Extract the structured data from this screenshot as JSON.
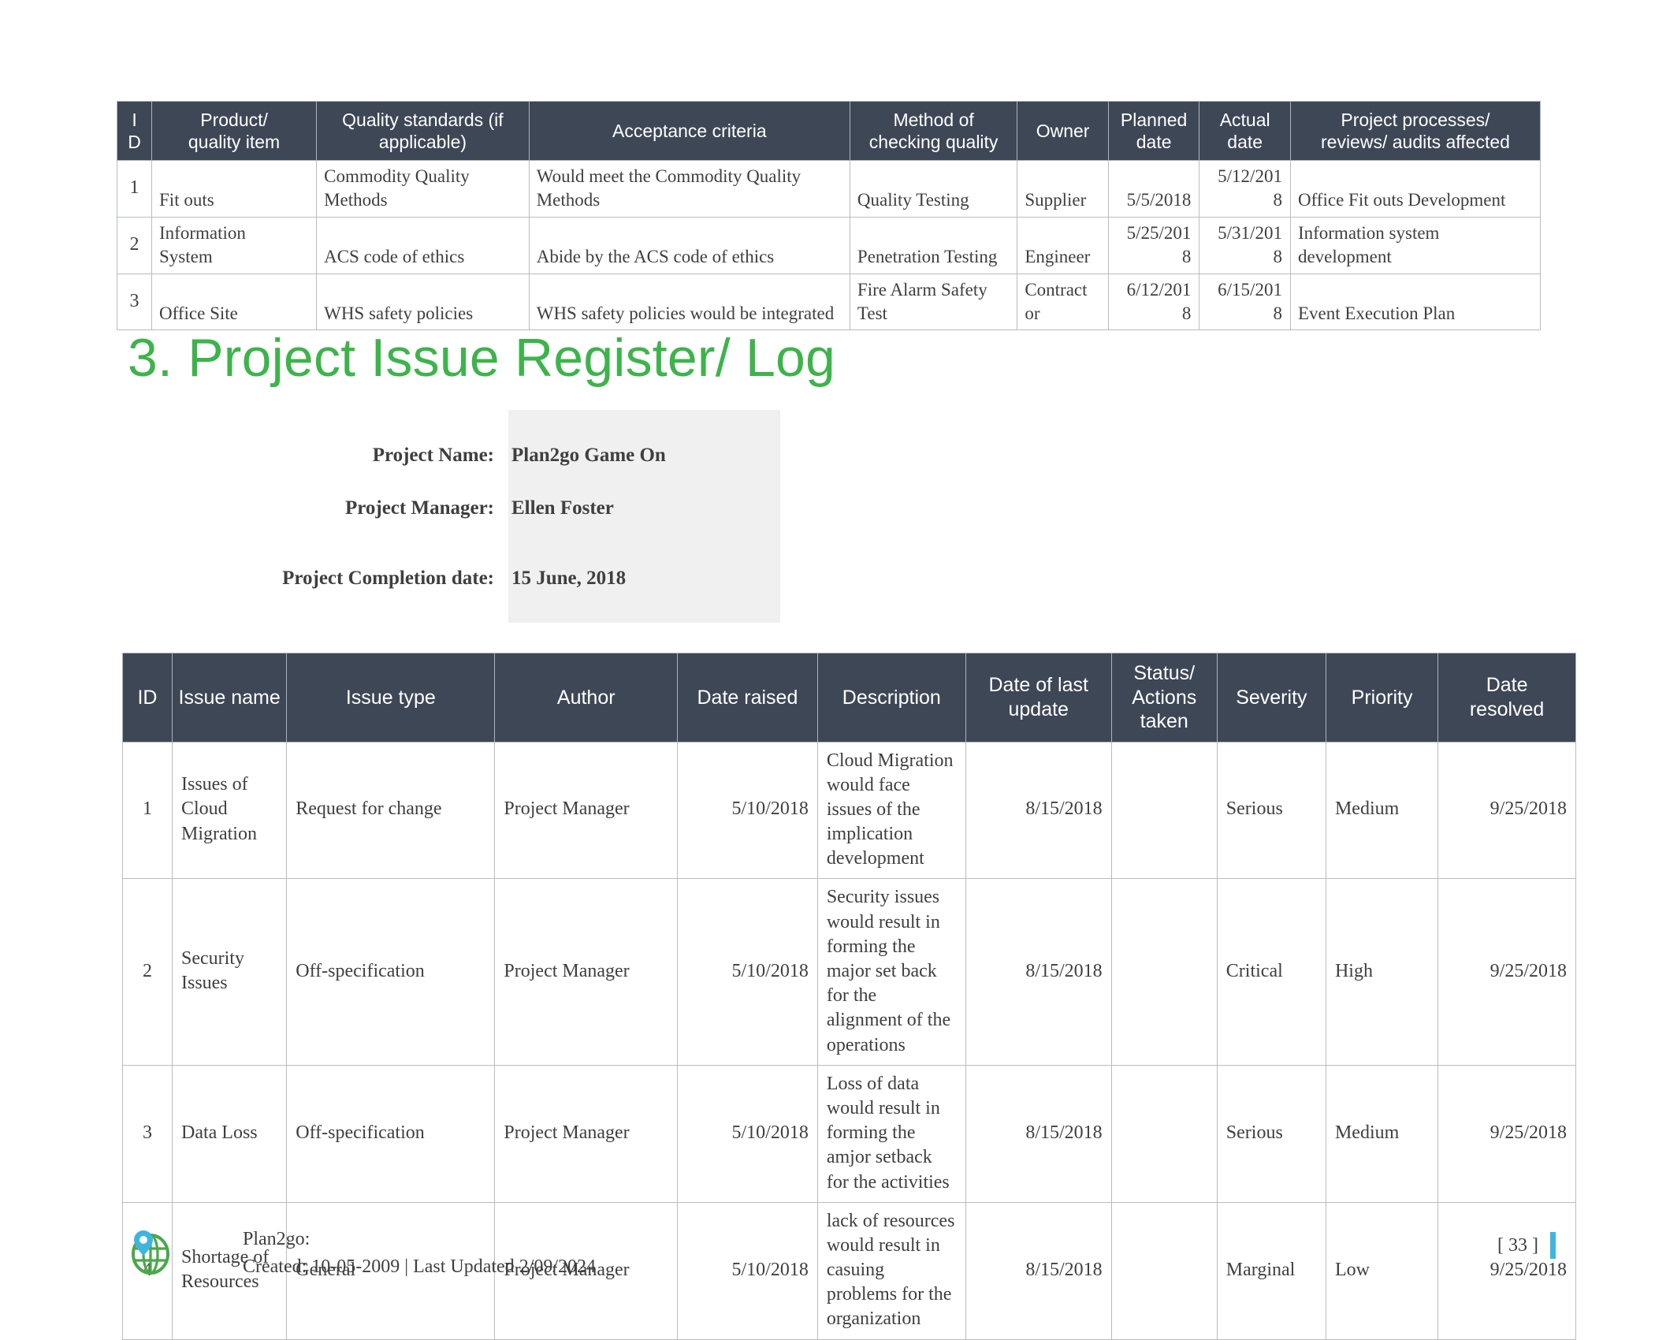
{
  "quality_table": {
    "headers": [
      "I\nD",
      "Product/\nquality item",
      "Quality standards (if applicable)",
      "Acceptance criteria",
      "Method of\nchecking quality",
      "Owner",
      "Planned\ndate",
      "Actual\ndate",
      "Project processes/\nreviews/ audits affected"
    ],
    "header_id_line1": "I",
    "header_id_line2": "D",
    "header_product_line1": "Product/",
    "header_product_line2": "quality item",
    "header_standards_line1": "Quality standards (if",
    "header_standards_line2": "applicable)",
    "header_acceptance": "Acceptance criteria",
    "header_method_line1": "Method of",
    "header_method_line2": "checking quality",
    "header_owner": "Owner",
    "header_planned_line1": "Planned",
    "header_planned_line2": "date",
    "header_actual_line1": "Actual",
    "header_actual_line2": "date",
    "header_processes_line1": "Project processes/",
    "header_processes_line2": "reviews/ audits affected",
    "rows": [
      {
        "id": "1",
        "item": "Fit outs",
        "standards_l1": "Commodity Quality",
        "standards_l2": "Methods",
        "acceptance_l1": "Would meet the Commodity Quality",
        "acceptance_l2": "Methods",
        "method_l1": "",
        "method_l2": "Quality Testing",
        "owner_l1": "",
        "owner_l2": "Supplier",
        "planned_l1": "",
        "planned_l2": "5/5/2018",
        "actual_l1": "5/12/201",
        "actual_l2": "8",
        "process_l1": "",
        "process_l2": "Office Fit outs Development"
      },
      {
        "id": "2",
        "item_l1": "Information",
        "item_l2": "System",
        "standards_l1": "",
        "standards_l2": "ACS code of ethics",
        "acceptance_l1": "",
        "acceptance_l2": "Abide by the ACS code of ethics",
        "method_l1": "",
        "method_l2": "Penetration Testing",
        "owner_l1": "",
        "owner_l2": "Engineer",
        "planned_l1": "5/25/201",
        "planned_l2": "8",
        "actual_l1": "5/31/201",
        "actual_l2": "8",
        "process_l1": "Information system",
        "process_l2": "development"
      },
      {
        "id": "3",
        "item_l1": "",
        "item_l2": "Office Site",
        "standards_l1": "",
        "standards_l2": "WHS safety policies",
        "acceptance_l1": "",
        "acceptance_l2": "WHS safety policies would be integrated",
        "method_l1": "Fire Alarm Safety",
        "method_l2": "Test",
        "owner_l1": "Contract",
        "owner_l2": "or",
        "planned_l1": "6/12/201",
        "planned_l2": "8",
        "actual_l1": "6/15/201",
        "actual_l2": "8",
        "process_l1": "",
        "process_l2": "Event Execution Plan"
      }
    ]
  },
  "section": {
    "heading": "3. Project Issue Register/ Log"
  },
  "project_info": {
    "name_label": "Project Name:",
    "name_value": "Plan2go Game On",
    "manager_label": "Project Manager:",
    "manager_value": "Ellen Foster",
    "completion_label": "Project Completion date:",
    "completion_value": "15 June, 2018"
  },
  "issue_table": {
    "header_id": "ID",
    "header_issue_name": "Issue name",
    "header_issue_type": "Issue type",
    "header_author": "Author",
    "header_date_raised": "Date raised",
    "header_description": "Description",
    "header_date_update_l1": "Date of last",
    "header_date_update_l2": "update",
    "header_status_l1": "Status/",
    "header_status_l2": "Actions",
    "header_status_l3": "taken",
    "header_severity": "Severity",
    "header_priority": "Priority",
    "header_date_resolved_l1": "Date",
    "header_date_resolved_l2": "resolved",
    "rows": [
      {
        "id": "1",
        "issue_name": "Issues of Cloud Migration",
        "issue_type": "Request for change",
        "author": "Project Manager",
        "date_raised": "5/10/2018",
        "description": "Cloud Migration would face issues of the implication development",
        "date_last_update": "8/15/2018",
        "status_actions": "",
        "severity": "Serious",
        "priority": "Medium",
        "date_resolved": "9/25/2018"
      },
      {
        "id": "2",
        "issue_name": "Security Issues",
        "issue_type": "Off-specification",
        "author": "Project Manager",
        "date_raised": "5/10/2018",
        "description": "Security issues would result in forming the major set back for the alignment of the operations",
        "date_last_update": "8/15/2018",
        "status_actions": "",
        "severity": "Critical",
        "priority": "High",
        "date_resolved": "9/25/2018"
      },
      {
        "id": "3",
        "issue_name": "Data Loss",
        "issue_type": "Off-specification",
        "author": "Project Manager",
        "date_raised": "5/10/2018",
        "description": "Loss of data would result in forming the amjor setback for the activities",
        "date_last_update": "8/15/2018",
        "status_actions": "",
        "severity": "Serious",
        "priority": "Medium",
        "date_resolved": "9/25/2018"
      },
      {
        "id": "4",
        "issue_name": "Shortage of Resources",
        "issue_type": "General",
        "author": "Project Manager",
        "date_raised": "5/10/2018",
        "description": "lack of resources would result in casuing problems for the organization",
        "date_last_update": "8/15/2018",
        "status_actions": "",
        "severity": "Marginal",
        "priority": "Low",
        "date_resolved": "9/25/2018"
      }
    ]
  },
  "footer": {
    "brand": "Plan2go:",
    "created_updated": "Created: 10-05-2009 | Last Updated 2/09/2024",
    "page_number": "[ 33 ]",
    "logo_name": "plan2go-globe-pin-logo"
  },
  "colors": {
    "header_bg": "#3e4756",
    "heading_green": "#3cb44a",
    "shade_gray": "#f0f0f0",
    "accent_blue": "#3eb5e0",
    "text": "#3f3f3f"
  }
}
